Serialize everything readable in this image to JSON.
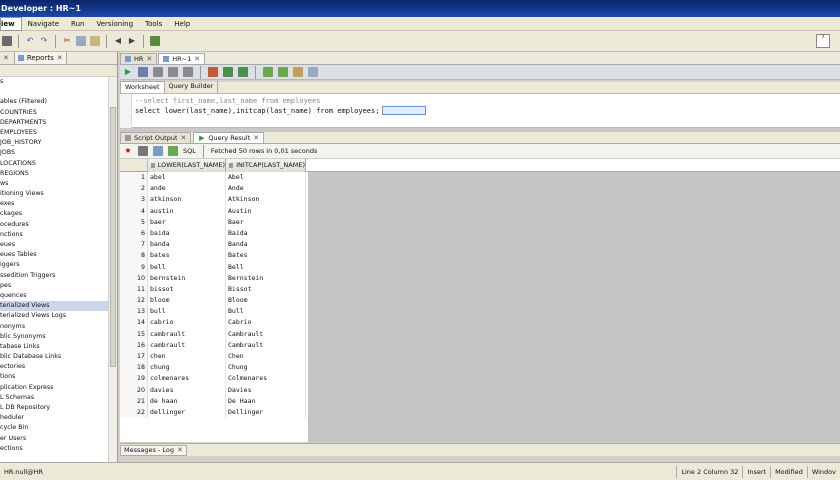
{
  "window": {
    "title": "Developer : HR~1"
  },
  "menu": [
    "iew",
    "Navigate",
    "Run",
    "Versioning",
    "Tools",
    "Help"
  ],
  "left_panel": {
    "tabs": [
      {
        "label": ""
      },
      {
        "label": "Reports"
      }
    ],
    "tree": [
      "s",
      "",
      "ables (Filtered)",
      "COUNTRIES",
      "DEPARTMENTS",
      "EMPLOYEES",
      "JOB_HISTORY",
      "JOBS",
      "LOCATIONS",
      "REGIONS",
      "ws",
      "itioning Views",
      "exes",
      "ckages",
      "ocedures",
      "nctions",
      "eues",
      "eues Tables",
      "iggers",
      "ssedition Triggers",
      "pes",
      "quences",
      "terialized Views",
      "terialized Views Logs",
      "nonyms",
      "blic Synonyms",
      "tabase Links",
      "blic Database Links",
      "ectories",
      "tions",
      "plication Express",
      "L Schemas",
      "L DB Repository",
      "heduler",
      "cycle Bin",
      "er Users",
      "ections"
    ],
    "selected_index": 22
  },
  "editor_tabs": [
    "HR",
    "HR~1"
  ],
  "worksheet_tabs": [
    "Worksheet",
    "Query Builder"
  ],
  "sql": {
    "line1": "--select first_name,last_name from employees",
    "line2": "select lower(last_name),initcap(last_name) from employees;"
  },
  "result_tabs": [
    "Script Output",
    "Query Result"
  ],
  "result_toolbar": {
    "sql_label": "SQL",
    "status": "Fetched 50 rows in 0,01 seconds"
  },
  "grid": {
    "columns": [
      "LOWER(LAST_NAME)",
      "INITCAP(LAST_NAME)"
    ],
    "rows": [
      [
        "1",
        "abel",
        "Abel"
      ],
      [
        "2",
        "ande",
        "Ande"
      ],
      [
        "3",
        "atkinson",
        "Atkinson"
      ],
      [
        "4",
        "austin",
        "Austin"
      ],
      [
        "5",
        "baer",
        "Baer"
      ],
      [
        "6",
        "baida",
        "Baida"
      ],
      [
        "7",
        "banda",
        "Banda"
      ],
      [
        "8",
        "bates",
        "Bates"
      ],
      [
        "9",
        "bell",
        "Bell"
      ],
      [
        "10",
        "bernstein",
        "Bernstein"
      ],
      [
        "11",
        "bissot",
        "Bissot"
      ],
      [
        "12",
        "bloom",
        "Bloom"
      ],
      [
        "13",
        "bull",
        "Bull"
      ],
      [
        "14",
        "cabrio",
        "Cabrio"
      ],
      [
        "15",
        "cambrault",
        "Cambrault"
      ],
      [
        "16",
        "cambrault",
        "Cambrault"
      ],
      [
        "17",
        "chen",
        "Chen"
      ],
      [
        "18",
        "chung",
        "Chung"
      ],
      [
        "19",
        "colmenares",
        "Colmenares"
      ],
      [
        "20",
        "davies",
        "Davies"
      ],
      [
        "21",
        "de haan",
        "De Haan"
      ],
      [
        "22",
        "dellinger",
        "Dellinger"
      ]
    ]
  },
  "log_tab": "Messages - Log",
  "status": {
    "connection": "HR.null@HR",
    "position": "Line 2 Column 32",
    "mode": "Insert",
    "state": "Modified",
    "os": "Windov"
  },
  "colors": {
    "title_bar": "#0a246a",
    "selection": "#c9d6ea",
    "run_green": "#2e9b2e"
  }
}
